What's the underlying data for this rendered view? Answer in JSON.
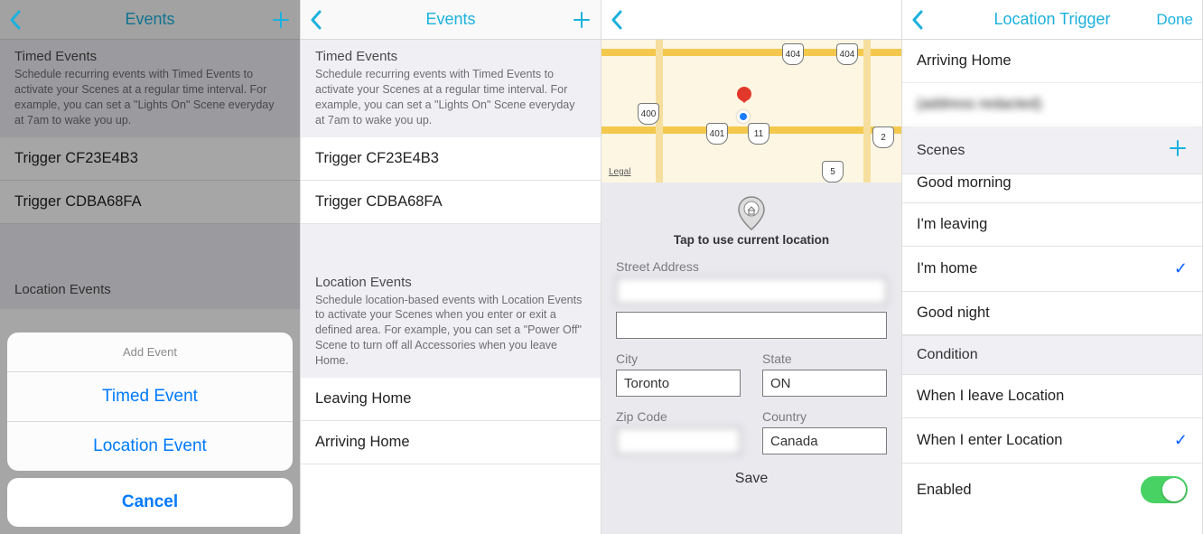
{
  "accent": "#1bb1dd",
  "ios_blue": "#007aff",
  "screen1": {
    "nav_title": "Events",
    "timed_header_title": "Timed Events",
    "timed_header_desc": "Schedule recurring events with Timed Events to activate your Scenes at a regular time interval. For example, you can set a \"Lights On\" Scene everyday at 7am to wake you up.",
    "triggers": [
      "Trigger CF23E4B3",
      "Trigger CDBA68FA"
    ],
    "location_header_title": "Location Events",
    "sheet_title": "Add Event",
    "sheet_items": [
      "Timed Event",
      "Location Event"
    ],
    "sheet_cancel": "Cancel"
  },
  "screen2": {
    "nav_title": "Events",
    "timed_header_title": "Timed Events",
    "timed_header_desc": "Schedule recurring events with Timed Events to activate your Scenes at a regular time interval. For example, you can set a \"Lights On\" Scene everyday at 7am to wake you up.",
    "triggers": [
      "Trigger CF23E4B3",
      "Trigger CDBA68FA"
    ],
    "location_header_title": "Location Events",
    "location_header_desc": "Schedule location-based events with Location Events to activate your Scenes when you enter or exit a defined area. For example, you can set a \"Power Off\" Scene to turn off all Accessories when you leave Home.",
    "location_items": [
      "Leaving Home",
      "Arriving Home"
    ]
  },
  "screen3": {
    "legal": "Legal",
    "shields": [
      "404",
      "404",
      "400",
      "401",
      "11",
      "5",
      "2"
    ],
    "tap_label": "Tap to use current location",
    "labels": {
      "street": "Street Address",
      "city": "City",
      "state": "State",
      "zip": "Zip Code",
      "country": "Country"
    },
    "values": {
      "street1": "",
      "street2": "",
      "city": "Toronto",
      "state": "ON",
      "zip": "",
      "country": "Canada"
    },
    "save": "Save"
  },
  "screen4": {
    "nav_title": "Location Trigger",
    "nav_done": "Done",
    "name": "Arriving Home",
    "address_blurred": "(address redacted)",
    "scenes_header": "Scenes",
    "scenes_partial": "Good morning",
    "scenes": [
      {
        "label": "I'm leaving",
        "checked": false
      },
      {
        "label": "I'm home",
        "checked": true
      },
      {
        "label": "Good night",
        "checked": false
      }
    ],
    "condition_header": "Condition",
    "conditions": [
      {
        "label": "When I leave Location",
        "checked": false
      },
      {
        "label": "When I enter Location",
        "checked": true
      }
    ],
    "enabled_label": "Enabled",
    "enabled": true
  }
}
